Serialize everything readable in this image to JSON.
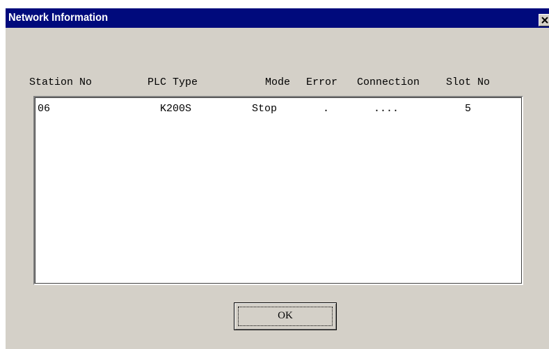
{
  "window": {
    "title": "Network Information"
  },
  "columns": [
    {
      "label": "Station No"
    },
    {
      "label": "PLC Type"
    },
    {
      "label": "Mode"
    },
    {
      "label": "Error"
    },
    {
      "label": "Connection"
    },
    {
      "label": "Slot No"
    }
  ],
  "rows": [
    {
      "station_no": "06",
      "plc_type": "K200S",
      "mode": "Stop",
      "error": ".",
      "connection": "....",
      "slot_no": "5"
    }
  ],
  "buttons": {
    "ok_label": "OK"
  },
  "icons": {
    "close": "close-icon"
  },
  "colors": {
    "titlebar": "#000a7c",
    "face": "#d4d0c8",
    "list_background": "#ffffff"
  }
}
